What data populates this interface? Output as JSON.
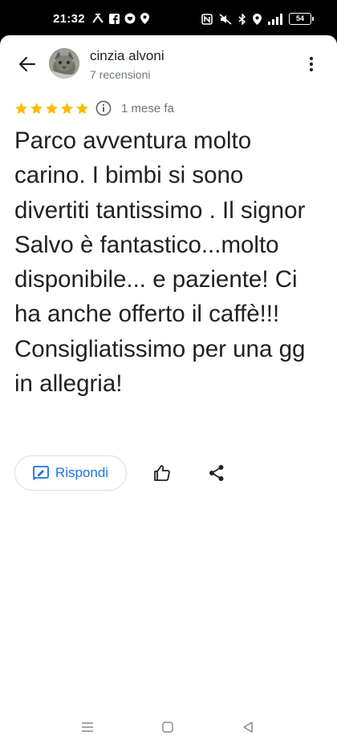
{
  "status_bar": {
    "time": "21:32",
    "battery": "54",
    "left_icons": [
      "call-forward-icon",
      "facebook-icon",
      "shield-icon",
      "location-icon"
    ],
    "right_icons": [
      "nfc-icon",
      "mute-icon",
      "bluetooth-icon",
      "location-icon",
      "signal-4g-icon"
    ]
  },
  "header": {
    "back_icon": "arrow-left-icon",
    "user_name": "cinzia alvoni",
    "review_count": "7 recensioni",
    "more_icon": "more-vert-icon"
  },
  "review": {
    "rating": 5,
    "max_rating": 5,
    "date": "1 mese fa",
    "text": "Parco avventura molto carino. I bimbi si sono divertiti tantissimo . Il signor Salvo è fantastico...molto disponibile... e paziente! Ci ha anche offerto il caffè!!! Consigliatissimo per una gg in allegria!"
  },
  "actions": {
    "reply_label": "Rispondi",
    "reply_icon": "reply-edit-icon",
    "like_icon": "thumb-up-icon",
    "share_icon": "share-icon"
  },
  "colors": {
    "star": "#fbbc04",
    "accent": "#1a73e8",
    "text": "#202124",
    "secondary_text": "#70757a"
  },
  "nav_bar": {
    "icons": [
      "recents-icon",
      "home-icon",
      "back-icon"
    ]
  }
}
